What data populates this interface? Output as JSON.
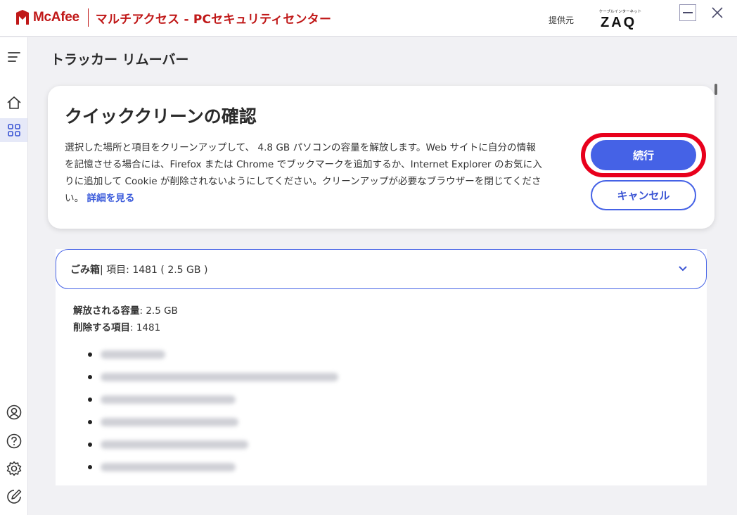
{
  "titlebar": {
    "brand": "McAfee",
    "app_title": "マルチアクセス - PCセキュリティセンター",
    "provider_label": "提供元",
    "provider_logo_sub": "ケーブルインターネット",
    "provider_logo_main": "ZAQ"
  },
  "page": {
    "title": "トラッカー リムーバー"
  },
  "card": {
    "title": "クイッククリーンの確認",
    "description": "選択した場所と項目をクリーンアップして、 4.8 GB パソコンの容量を解放します。Web サイトに自分の情報を記憶させる場合には、Firefox または Chrome でブックマークを追加するか、Internet Explorer のお気に入りに追加して Cookie が削除されないようにしてください。クリーンアップが必要なブラウザーを閉じてください。",
    "details_link": "詳細を見る",
    "continue_label": "続行",
    "cancel_label": "キャンセル"
  },
  "trash": {
    "name": "ごみ箱",
    "meta": "| 項目: 1481 ( 2.5 GB )",
    "freed_label": "解放される容量",
    "freed_value": ": 2.5 GB",
    "items_label": "削除する項目",
    "items_value": ": 1481"
  },
  "icons": {
    "menu": "menu-icon",
    "home": "home-icon",
    "apps": "apps-grid-icon",
    "account": "account-icon",
    "help": "help-icon",
    "settings": "settings-icon",
    "feedback": "feedback-icon"
  },
  "colors": {
    "brand_red": "#c01818",
    "accent_blue": "#4562e6",
    "highlight_red": "#e8001c"
  }
}
